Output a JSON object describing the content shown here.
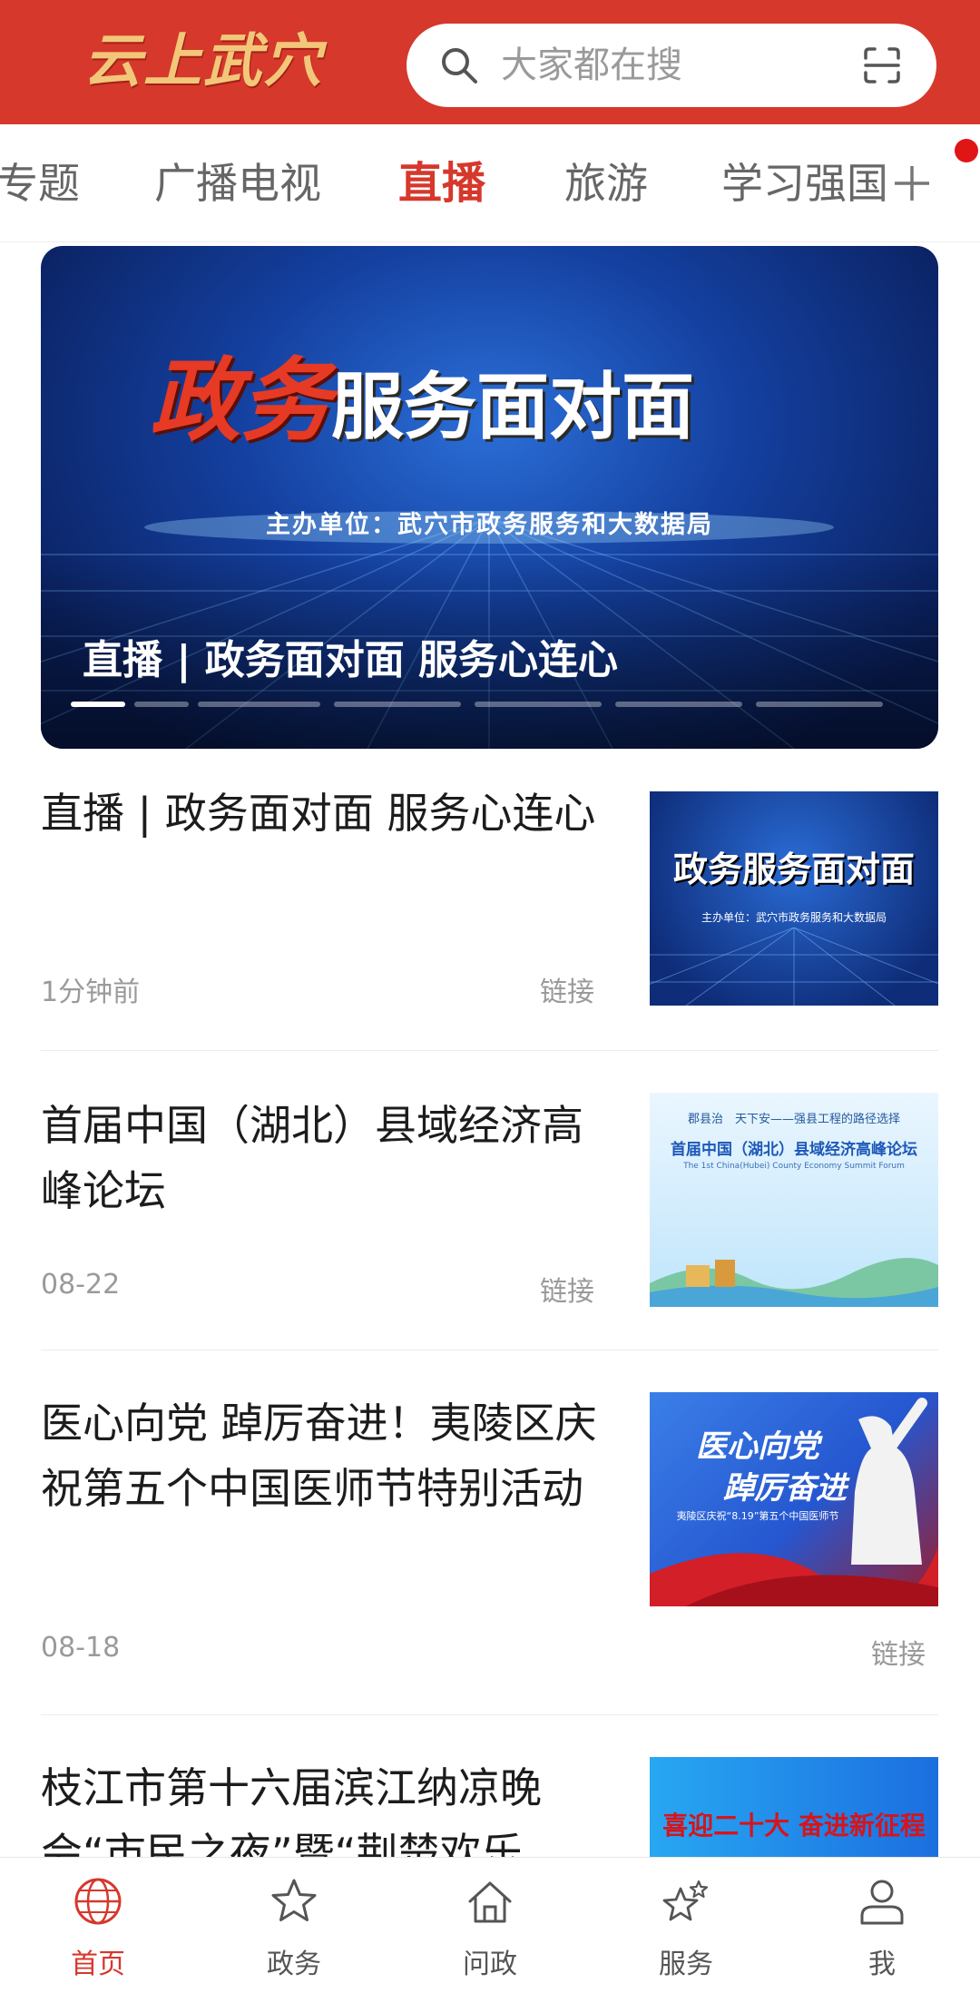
{
  "header": {
    "logo_text": "云上武穴",
    "search_placeholder": "大家都在搜",
    "brand_color": "#d6382c"
  },
  "tabs": [
    {
      "label": "专题",
      "active": false
    },
    {
      "label": "广播电视",
      "active": false
    },
    {
      "label": "直播",
      "active": true
    },
    {
      "label": "旅游",
      "active": false
    },
    {
      "label": "学习强国",
      "active": false
    }
  ],
  "banner": {
    "headline_red": "政务",
    "headline_white_1": "服务",
    "headline_white_2": "面对面",
    "subtitle": "主办单位：武穴市政务服务和大数据局",
    "caption": "直播 | 政务面对面 服务心连心",
    "slide_count": 6,
    "active_slide": 1
  },
  "news": [
    {
      "title": "直播 | 政务面对面 服务心连心",
      "time": "1分钟前",
      "type": "链接",
      "thumb_text_1": "政务服务面对面",
      "thumb_text_2": "主办单位：武穴市政务服务和大数据局"
    },
    {
      "title": "首届中国（湖北）县域经济高峰论坛",
      "time": "08-22",
      "type": "链接",
      "thumb_text_1": "郡县治　天下安——强县工程的路径选择",
      "thumb_text_2": "首届中国（湖北）县域经济高峰论坛",
      "thumb_text_3": "The 1st China(Hubei) County Economy Summit Forum"
    },
    {
      "title": "医心向党 踔厉奋进！夷陵区庆祝第五个中国医师节特别活动",
      "time": "08-18",
      "type": "链接",
      "thumb_text_1": "医心向党",
      "thumb_text_2": "踔厉奋进",
      "thumb_text_3": "夷陵区庆祝“8.19”第五个中国医师节"
    },
    {
      "title": "枝江市第十六届滨江纳凉晚会“市民之夜”暨“荆楚欢乐",
      "thumb_text_1": "喜迎二十大 奋进新征程"
    }
  ],
  "bottom_nav": [
    {
      "label": "首页",
      "icon": "home-globe-icon",
      "active": true
    },
    {
      "label": "政务",
      "icon": "star-icon",
      "active": false
    },
    {
      "label": "问政",
      "icon": "house-icon",
      "active": false
    },
    {
      "label": "服务",
      "icon": "stars-icon",
      "active": false
    },
    {
      "label": "我",
      "icon": "user-icon",
      "active": false
    }
  ]
}
